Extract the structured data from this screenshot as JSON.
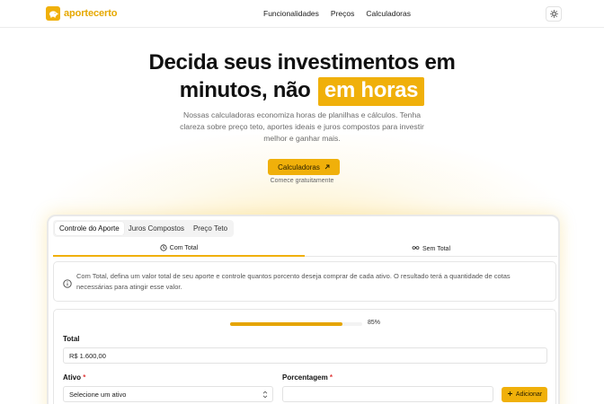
{
  "brand": {
    "name": "aportecerto",
    "accent": "#f0b00a"
  },
  "nav": {
    "items": [
      "Funcionalidades",
      "Preços",
      "Calculadoras"
    ]
  },
  "theme_toggle_icon": "sun-icon",
  "hero": {
    "title_line1": "Decida seus investimentos em",
    "title_line2_prefix": "minutos, não",
    "title_highlight": "em horas",
    "subtitle": "Nossas calculadoras economiza horas de planilhas e cálculos. Tenha clareza sobre preço teto, aportes ideais e juros compostos para investir melhor e ganhar mais.",
    "cta_label": "Calculadoras",
    "cta_note": "Comece gratuitamente"
  },
  "app": {
    "tabs": [
      "Controle do Aporte",
      "Juros Compostos",
      "Preço Teto"
    ],
    "active_tab": "Controle do Aporte",
    "subtabs": [
      "Com Total",
      "Sem Total"
    ],
    "info_text": "Com Total, defina um valor total de seu aporte e controle quantos porcento deseja comprar de cada ativo. O resultado terá a quantidade de cotas necessárias para atingir esse valor.",
    "progress": {
      "percent": 85,
      "label": "85%"
    },
    "form": {
      "total_label": "Total",
      "total_value": "R$ 1.600,00",
      "ativo_label": "Ativo",
      "ativo_placeholder": "Selecione um ativo",
      "porcentagem_label": "Porcentagem",
      "porcentagem_value": "",
      "required_mark": "*",
      "add_label": "Adicionar"
    }
  }
}
